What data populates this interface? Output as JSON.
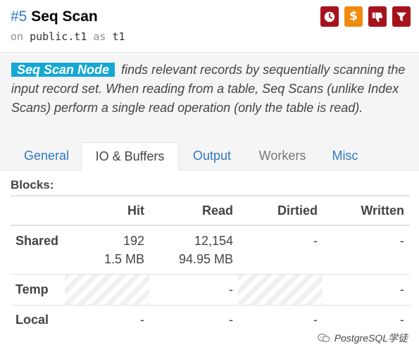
{
  "node": {
    "number": "#5",
    "name": "Seq Scan",
    "on_kw": "on",
    "relation": "public.t1",
    "as_kw": "as",
    "alias": "t1"
  },
  "icons": [
    "clock-icon",
    "dollar-icon",
    "thumbs-down-icon",
    "filter-icon"
  ],
  "icon_glyphs": {
    "dollar": "$"
  },
  "description": {
    "tag": "Seq Scan Node",
    "text": "finds relevant records by sequentially scanning the input record set. When reading from a table, Seq Scans (unlike Index Scans) perform a single read operation (only the table is read)."
  },
  "tabs": [
    {
      "label": "General",
      "state": "normal"
    },
    {
      "label": "IO & Buffers",
      "state": "active"
    },
    {
      "label": "Output",
      "state": "normal"
    },
    {
      "label": "Workers",
      "state": "disabled"
    },
    {
      "label": "Misc",
      "state": "normal"
    }
  ],
  "blocks": {
    "title": "Blocks:",
    "columns": [
      "Hit",
      "Read",
      "Dirtied",
      "Written"
    ],
    "rows": [
      {
        "label": "Shared",
        "hit": "192",
        "hit_size": "1.5 MB",
        "read": "12,154",
        "read_size": "94.95 MB",
        "dirtied": "-",
        "written": "-"
      },
      {
        "label": "Temp",
        "hit": "",
        "read": "-",
        "dirtied": "",
        "written": "-"
      },
      {
        "label": "Local",
        "hit": "-",
        "read": "-",
        "dirtied": "-",
        "written": "-"
      }
    ]
  },
  "watermark": "PostgreSQL学徒",
  "colors": {
    "link": "#2f78c4",
    "icon_red": "#a5141d",
    "icon_orange": "#f08a0c",
    "tag_bg": "#15a8d4"
  }
}
